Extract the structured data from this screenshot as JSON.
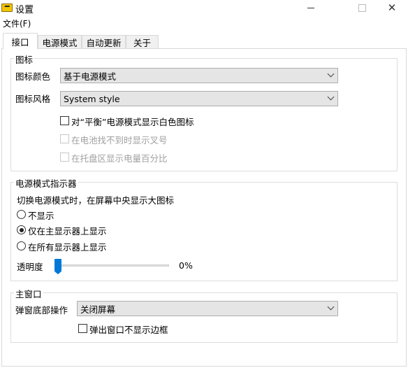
{
  "window": {
    "title": "设置",
    "minimize_glyph": "",
    "close_glyph": "✕"
  },
  "menu": {
    "file": "文件(F)"
  },
  "tabs": [
    {
      "label": "接口",
      "active": true
    },
    {
      "label": "电源模式",
      "active": false
    },
    {
      "label": "自动更新",
      "active": false
    },
    {
      "label": "关于",
      "active": false
    }
  ],
  "icon_group": {
    "title": "图标",
    "color_label": "图标颜色",
    "color_value": "基于电源模式",
    "style_label": "图标风格",
    "style_value": "System style",
    "checkboxes": [
      {
        "label": "对“平衡”电源模式显示白色图标",
        "checked": false,
        "enabled": true
      },
      {
        "label": "在电池找不到时显示叉号",
        "checked": false,
        "enabled": false
      },
      {
        "label": "在托盘区显示电量百分比",
        "checked": false,
        "enabled": false
      }
    ]
  },
  "indicator_group": {
    "title": "电源模式指示器",
    "description": "切换电源模式时，在屏幕中央显示大图标",
    "radios": [
      {
        "label": "不显示",
        "selected": false
      },
      {
        "label": "仅在主显示器上显示",
        "selected": true
      },
      {
        "label": "在所有显示器上显示",
        "selected": false
      }
    ],
    "opacity_label": "透明度",
    "opacity_value": "0%",
    "opacity_fraction": 0
  },
  "main_window_group": {
    "title": "主窗口",
    "bottom_action_label": "弹窗底部操作",
    "bottom_action_value": "关闭屏幕",
    "no_border_label": "弹出窗口不显示边框",
    "no_border_checked": false
  },
  "colors": {
    "accent": "#0078d7",
    "combo_bg": "#e5e5e5",
    "disabled_text": "#a0a0a0"
  }
}
